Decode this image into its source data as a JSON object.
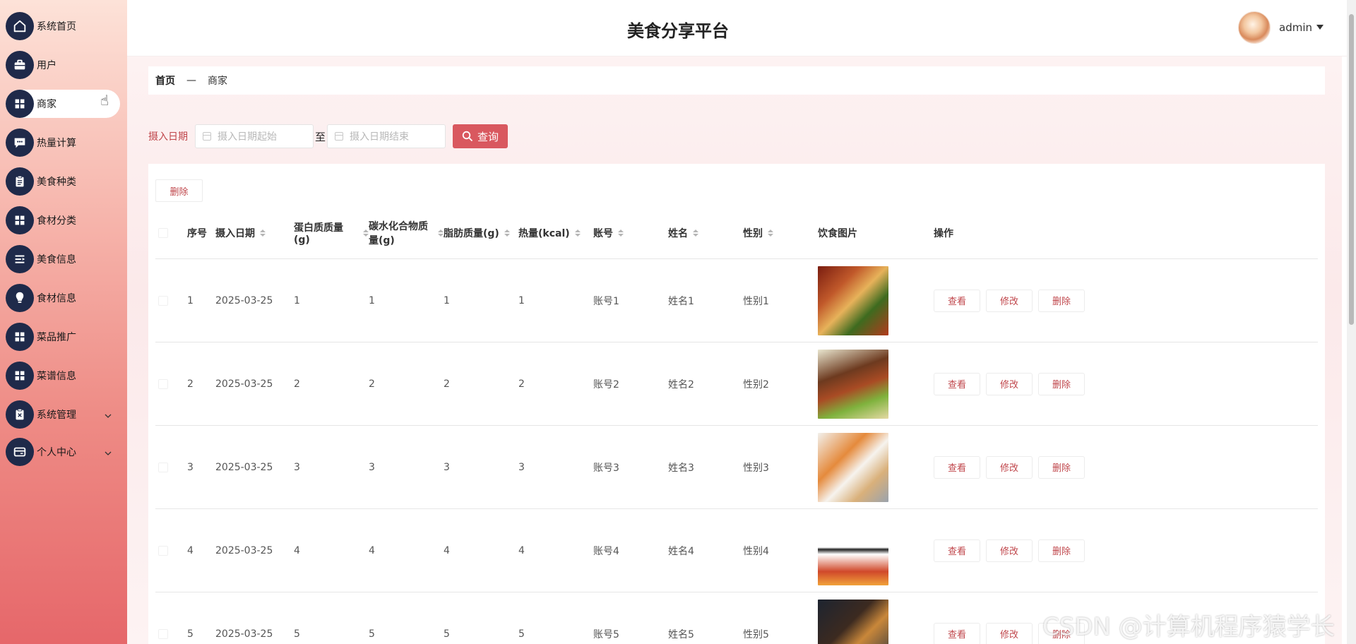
{
  "app": {
    "title": "美食分享平台"
  },
  "user": {
    "name": "admin"
  },
  "sidebar": {
    "items": [
      {
        "label": "系统首页",
        "icon": "home-icon",
        "active": false,
        "expandable": false
      },
      {
        "label": "用户",
        "icon": "briefcase-icon",
        "active": false,
        "expandable": false
      },
      {
        "label": "商家",
        "icon": "grid-icon",
        "active": true,
        "expandable": false
      },
      {
        "label": "热量计算",
        "icon": "chat-icon",
        "active": false,
        "expandable": false
      },
      {
        "label": "美食种类",
        "icon": "clipboard-icon",
        "active": false,
        "expandable": false
      },
      {
        "label": "食材分类",
        "icon": "grid-icon",
        "active": false,
        "expandable": false
      },
      {
        "label": "美食信息",
        "icon": "list-icon",
        "active": false,
        "expandable": false
      },
      {
        "label": "食材信息",
        "icon": "bulb-icon",
        "active": false,
        "expandable": false
      },
      {
        "label": "菜品推广",
        "icon": "grid-icon",
        "active": false,
        "expandable": false
      },
      {
        "label": "菜谱信息",
        "icon": "grid-icon",
        "active": false,
        "expandable": false
      },
      {
        "label": "系统管理",
        "icon": "x-clipboard-icon",
        "active": false,
        "expandable": true
      },
      {
        "label": "个人中心",
        "icon": "wallet-icon",
        "active": false,
        "expandable": true
      }
    ]
  },
  "breadcrumb": {
    "home": "首页",
    "separator": "—",
    "current": "商家"
  },
  "search": {
    "label": "摄入日期",
    "start_placeholder": "摄入日期起始",
    "end_placeholder": "摄入日期结束",
    "separator": "至",
    "button_label": "查询"
  },
  "toolbar": {
    "delete_label": "删除"
  },
  "table": {
    "columns": [
      {
        "label": "序号",
        "sortable": false
      },
      {
        "label": "摄入日期",
        "sortable": true
      },
      {
        "label": "蛋白质质量(g)",
        "sortable": true
      },
      {
        "label": "碳水化合物质量(g)",
        "sortable": true
      },
      {
        "label": "脂肪质量(g)",
        "sortable": true
      },
      {
        "label": "热量(kcal)",
        "sortable": true
      },
      {
        "label": "账号",
        "sortable": true
      },
      {
        "label": "姓名",
        "sortable": true
      },
      {
        "label": "性别",
        "sortable": true
      },
      {
        "label": "饮食图片",
        "sortable": false
      },
      {
        "label": "操作",
        "sortable": false
      }
    ],
    "rows": [
      {
        "no": "1",
        "date": "2025-03-25",
        "protein": "1",
        "carbs": "1",
        "fat": "1",
        "kcal": "1",
        "account": "账号1",
        "name": "姓名1",
        "gender": "性别1"
      },
      {
        "no": "2",
        "date": "2025-03-25",
        "protein": "2",
        "carbs": "2",
        "fat": "2",
        "kcal": "2",
        "account": "账号2",
        "name": "姓名2",
        "gender": "性别2"
      },
      {
        "no": "3",
        "date": "2025-03-25",
        "protein": "3",
        "carbs": "3",
        "fat": "3",
        "kcal": "3",
        "account": "账号3",
        "name": "姓名3",
        "gender": "性别3"
      },
      {
        "no": "4",
        "date": "2025-03-25",
        "protein": "4",
        "carbs": "4",
        "fat": "4",
        "kcal": "4",
        "account": "账号4",
        "name": "姓名4",
        "gender": "性别4"
      },
      {
        "no": "5",
        "date": "2025-03-25",
        "protein": "5",
        "carbs": "5",
        "fat": "5",
        "kcal": "5",
        "account": "账号5",
        "name": "姓名5",
        "gender": "性别5"
      }
    ],
    "actions": {
      "view": "查看",
      "edit": "修改",
      "delete": "删除"
    }
  },
  "watermark": "CSDN @计算机程序猿学长",
  "colors": {
    "accent": "#d9585f",
    "sidebar_icon_bg": "#1f2a4a",
    "link_red": "#c0474c"
  }
}
